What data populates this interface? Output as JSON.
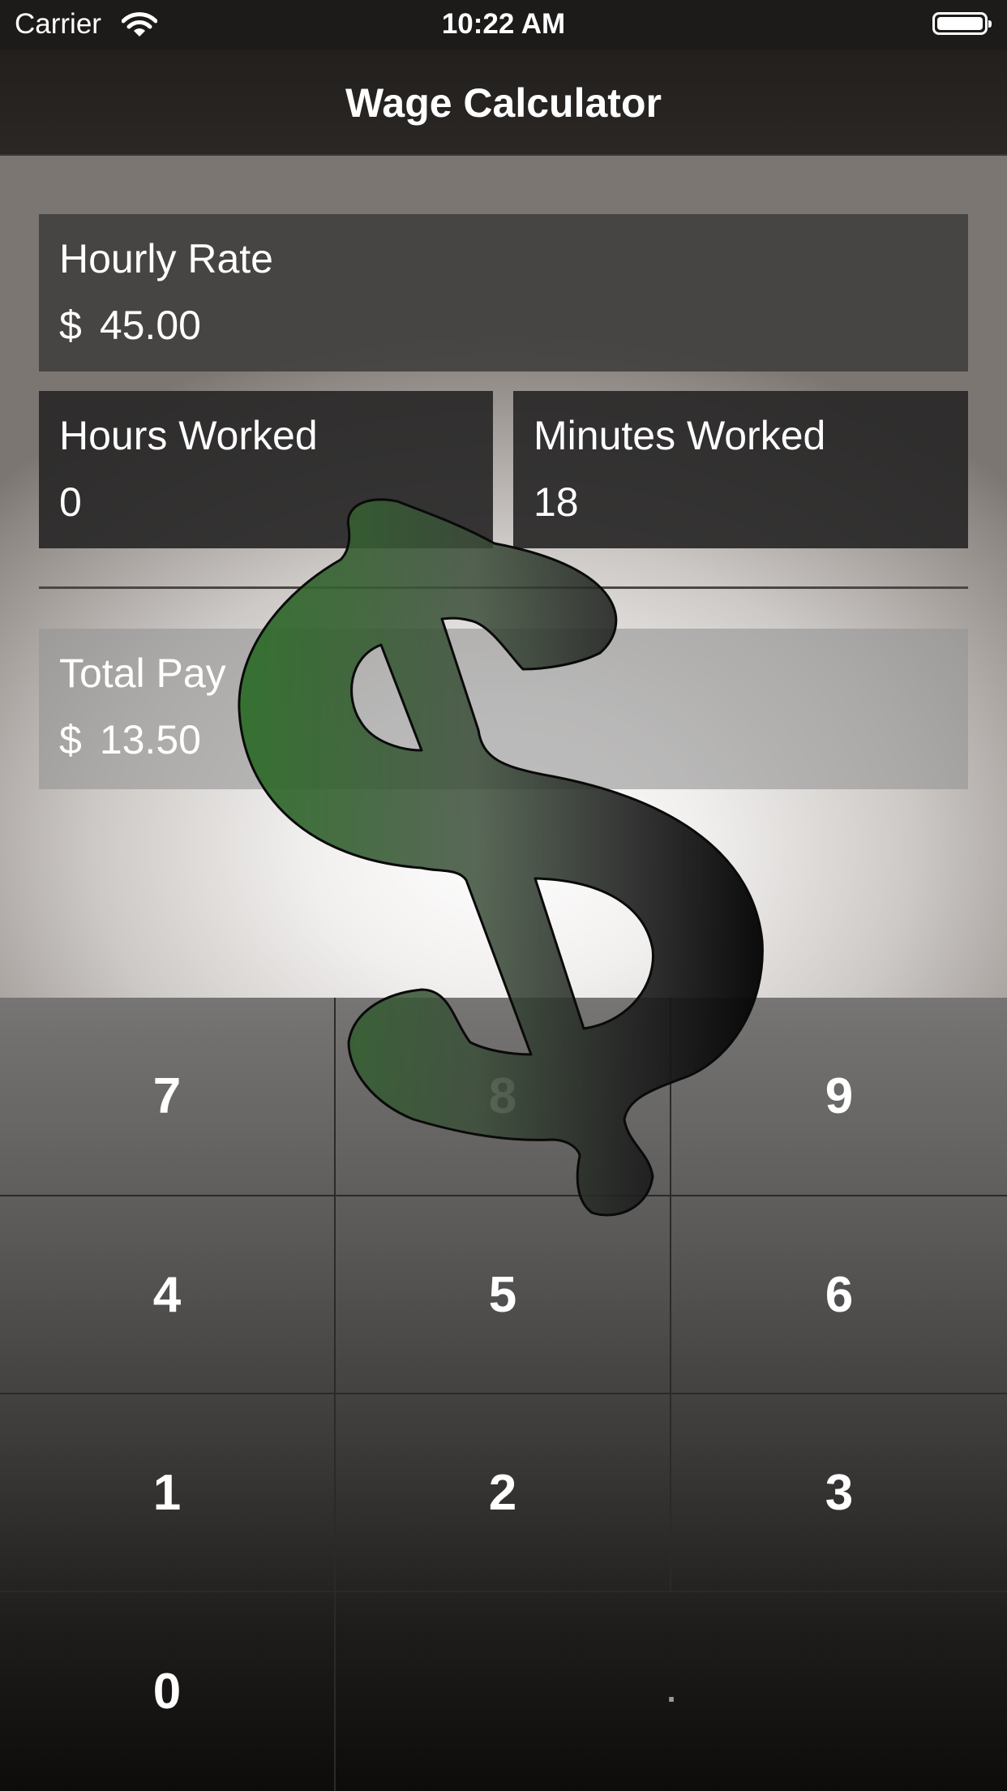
{
  "status_bar": {
    "carrier": "Carrier",
    "time": "10:22 AM"
  },
  "nav": {
    "title": "Wage Calculator"
  },
  "fields": {
    "hourly_rate": {
      "label": "Hourly Rate",
      "currency": "$",
      "value": "45.00"
    },
    "hours_worked": {
      "label": "Hours Worked",
      "value": "0"
    },
    "minutes_worked": {
      "label": "Minutes Worked",
      "value": "18"
    },
    "total_pay": {
      "label": "Total Pay",
      "currency": "$",
      "value": "13.50"
    }
  },
  "keypad": {
    "keys": [
      "7",
      "8",
      "9",
      "4",
      "5",
      "6",
      "1",
      "2",
      "3",
      "0",
      "."
    ]
  },
  "colors": {
    "dollar_green": "#2f6e2a",
    "dollar_dark": "#0d0d0d",
    "field_dark": "#282727",
    "text": "#ffffff"
  },
  "icons": [
    "wifi-icon",
    "battery-icon",
    "dollar-sign-icon"
  ]
}
